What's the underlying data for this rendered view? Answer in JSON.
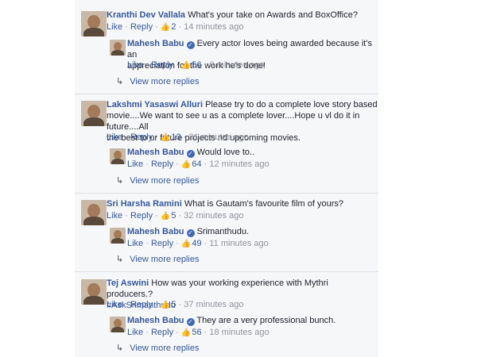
{
  "threads": [
    {
      "author": "Kranthi Dev Vallala",
      "text": "What's your take on Awards and BoxOffice?",
      "like": "Like",
      "reply": "Reply",
      "likes": "2",
      "time": "14 minutes ago",
      "reply_author": "Mahesh Babu",
      "reply_text_1": "Every actor loves being awarded because it's an",
      "reply_text_2": "appreciation for the work he's done!",
      "reply_likes": "56",
      "reply_time": "6 minutes ago",
      "view_more": "View more replies"
    },
    {
      "author": "Lakshmi Yasaswi Alluri",
      "text_1": "Please try to do a complete love story based",
      "text_2": "movie....We want to see u as a complete lover....Hope u vl do it in future....All",
      "text_3": "the best to ur future projects nd upcoming movies.",
      "like": "Like",
      "reply": "Reply",
      "likes": "13",
      "time": "31 minutes ago",
      "reply_author": "Mahesh Babu",
      "reply_text": "Would love to..",
      "reply_likes": "64",
      "reply_time": "12 minutes ago",
      "view_more": "View more replies"
    },
    {
      "author": "Sri Harsha Ramini",
      "text": "What is Gautam's favourite film of yours?",
      "like": "Like",
      "reply": "Reply",
      "likes": "5",
      "time": "32 minutes ago",
      "reply_author": "Mahesh Babu",
      "reply_text": "Srimanthudu.",
      "reply_likes": "49",
      "reply_time": "11 minutes ago",
      "view_more": "View more replies"
    },
    {
      "author": "Tej Aswini",
      "text_1": "How was your working experience with Mythri producers.?",
      "text_2": "#AskSrimanthudu",
      "like": "Like",
      "reply": "Reply",
      "likes": "5",
      "time": "37 minutes ago",
      "reply_author": "Mahesh Babu",
      "reply_text": "They are a very professional bunch.",
      "reply_likes": "56",
      "reply_time": "18 minutes ago",
      "view_more": "View more replies"
    }
  ],
  "colors": {
    "link": "#365899",
    "meta": "#90949c",
    "panel_bg": "#f6f7f9"
  },
  "icons": {
    "thumbs_up": "thumbs-up-icon",
    "verified": "verified-badge-icon",
    "reply_arrow": "reply-arrow-icon"
  }
}
